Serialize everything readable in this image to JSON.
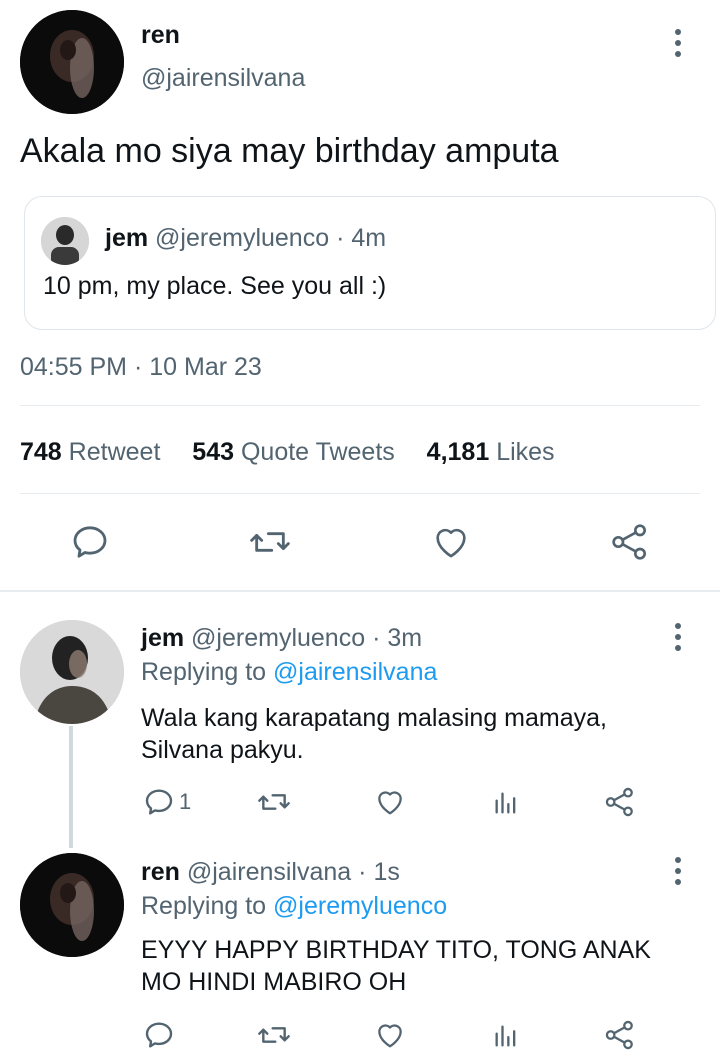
{
  "main_tweet": {
    "name": "ren",
    "handle": "@jairensilvana",
    "text": "Akala mo siya may birthday amputa",
    "quoted": {
      "name": "jem",
      "handle": "@jeremyluenco",
      "dot": "·",
      "time": "4m",
      "text": "10 pm, my place. See you all :)"
    },
    "time": "04:55 PM",
    "dot": "·",
    "date": "10 Mar 23",
    "stats": {
      "retweets_count": "748",
      "retweets_label": "Retweet",
      "quotes_count": "543",
      "quotes_label": "Quote Tweets",
      "likes_count": "4,181",
      "likes_label": "Likes"
    }
  },
  "replies": [
    {
      "name": "jem",
      "handle": "@jeremyluenco",
      "dot": "·",
      "time": "3m",
      "replying_prefix": "Replying to",
      "replying_to": "@jairensilvana",
      "text_line1": "Wala kang karapatang malasing mamaya,",
      "text_line2": "Silvana pakyu.",
      "reply_count": "1"
    },
    {
      "name": "ren",
      "handle": "@jairensilvana",
      "dot": "·",
      "time": "1s",
      "replying_prefix": "Replying to",
      "replying_to": "@jeremyluenco",
      "text_line1": "EYYY HAPPY BIRTHDAY TITO, TONG ANAK",
      "text_line2": "MO HINDI MABIRO OH",
      "reply_count": ""
    }
  ],
  "icons": {
    "reply": "reply-icon",
    "retweet": "retweet-icon",
    "like": "heart-icon",
    "share": "share-icon",
    "analytics": "analytics-icon",
    "more": "more-vertical-icon"
  },
  "colors": {
    "text": "#0f1419",
    "secondary": "#536471",
    "link": "#1d9bf0",
    "divider": "#e6ecf0"
  }
}
